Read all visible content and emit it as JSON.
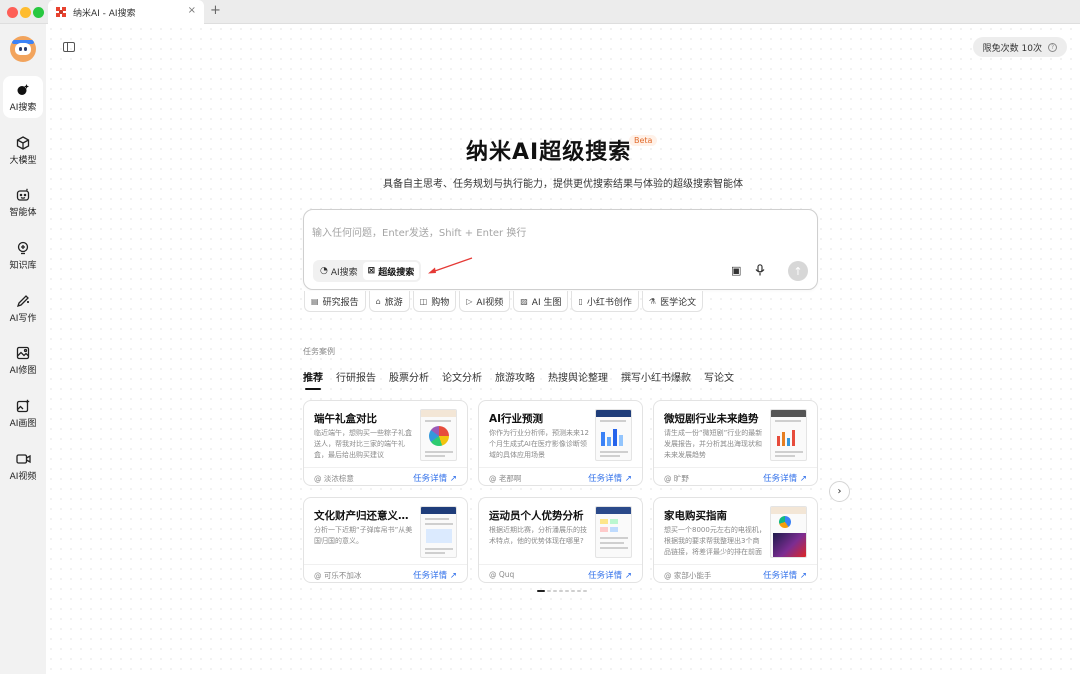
{
  "window": {
    "tab_title": "纳米AI - AI搜索",
    "close_glyph": "×",
    "new_tab_glyph": "+"
  },
  "sidebar": {
    "items": [
      {
        "label": "AI搜索",
        "icon": "search-sparkle-icon",
        "active": true
      },
      {
        "label": "大模型",
        "icon": "cube-icon",
        "active": false
      },
      {
        "label": "智能体",
        "icon": "robot-icon",
        "active": false
      },
      {
        "label": "知识库",
        "icon": "bulb-icon",
        "active": false
      },
      {
        "label": "AI写作",
        "icon": "pen-icon",
        "active": false
      },
      {
        "label": "AI修图",
        "icon": "image-icon",
        "active": false
      },
      {
        "label": "AI画图",
        "icon": "image-plus-icon",
        "active": false
      },
      {
        "label": "AI视频",
        "icon": "video-icon",
        "active": false
      }
    ]
  },
  "header": {
    "quota_label": "限免次数 10次",
    "help_glyph": "?"
  },
  "hero": {
    "title": "纳米AI超级搜索",
    "badge": "Beta",
    "subtitle": "具备自主思考、任务规划与执行能力，提供更优搜索结果与体验的超级搜索智能体"
  },
  "search": {
    "placeholder": "输入任何问题，Enter发送，Shift + Enter 换行",
    "modes": [
      {
        "label": "AI搜索",
        "icon": "search-sparkle-icon",
        "selected": false
      },
      {
        "label": "超级搜索",
        "icon": "grid-icon",
        "selected": true
      }
    ],
    "image_glyph": "▣",
    "mic_glyph": "🎙",
    "send_glyph": "↑"
  },
  "chips": [
    {
      "label": "研究报告",
      "icon": "▤"
    },
    {
      "label": "旅游",
      "icon": "⌂"
    },
    {
      "label": "购物",
      "icon": "◫"
    },
    {
      "label": "AI视频",
      "icon": "▷"
    },
    {
      "label": "AI 生图",
      "icon": "▨"
    },
    {
      "label": "小红书创作",
      "icon": "▯"
    },
    {
      "label": "医学论文",
      "icon": "⚗"
    }
  ],
  "cases": {
    "section_label": "任务案例",
    "tabs": [
      "推荐",
      "行研报告",
      "股票分析",
      "论文分析",
      "旅游攻略",
      "热搜舆论整理",
      "撰写小红书爆款",
      "写论文"
    ],
    "active_tab": "推荐",
    "link_label": "任务详情 ↗",
    "next_glyph": "›",
    "cards": [
      {
        "title": "端午礼盒对比",
        "desc": "临近端午，想购买一些粽子礼盒送人，帮我对比三家的端午礼盒，最后给出购买建议",
        "author": "@ 淡浓棕意"
      },
      {
        "title": "AI行业预测",
        "desc": "你作为行业分析师，预测未来12个月生成式AI在医疗影像诊断领域的具体应用场景",
        "author": "@ 老那啊"
      },
      {
        "title": "微短剧行业未来趋势",
        "desc": "请生成一份“微短剧”行业的最新发展报告，并分析其出海现状和未来发展趋势",
        "author": "@ 旷野"
      },
      {
        "title": "文化财产归还意义的分析",
        "desc": "分析一下近期“子弹库帛书”从美国归国的意义。",
        "author": "@ 可乐不加冰"
      },
      {
        "title": "运动员个人优势分析",
        "desc": "根据近期比赛，分析潘展乐的技术特点，他的优势体现在哪里?",
        "author": "@ Quq"
      },
      {
        "title": "家电购买指南",
        "desc": "想买一个8000元左右的电视机，根据我的要求帮我整理出3个商品链接，将差评最少的排在前面",
        "author": "@ 家部小能手"
      }
    ],
    "page_dots": 8,
    "active_dot": 0
  },
  "colors": {
    "accent_link": "#2f6fea",
    "beta_text": "#e06a2a",
    "annotation_arrow": "#e53935"
  }
}
